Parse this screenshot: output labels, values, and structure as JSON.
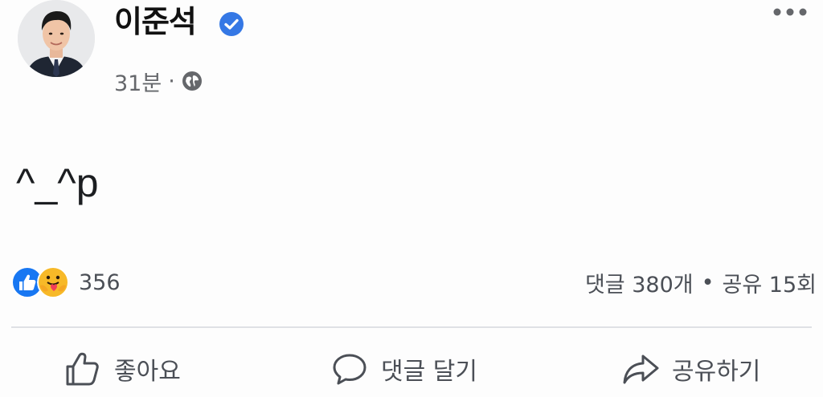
{
  "post": {
    "author": "이준석",
    "verified": true,
    "time": "31분",
    "meta_separator": "·",
    "audience_icon": "globe-icon",
    "more_icon": "more-horizontal-icon",
    "text": "^_^p"
  },
  "reactions": {
    "types": [
      "like-icon",
      "care-icon"
    ],
    "count": "356"
  },
  "engagement": {
    "comments": "댓글 380개",
    "separator": "•",
    "shares": "공유 15회"
  },
  "actions": {
    "like_label": "좋아요",
    "comment_label": "댓글 달기",
    "share_label": "공유하기"
  },
  "colors": {
    "verified_blue": "#3578e5",
    "like_blue": "#1877f2",
    "care_yellow": "#f7b928",
    "secondary_text": "#65676b"
  }
}
